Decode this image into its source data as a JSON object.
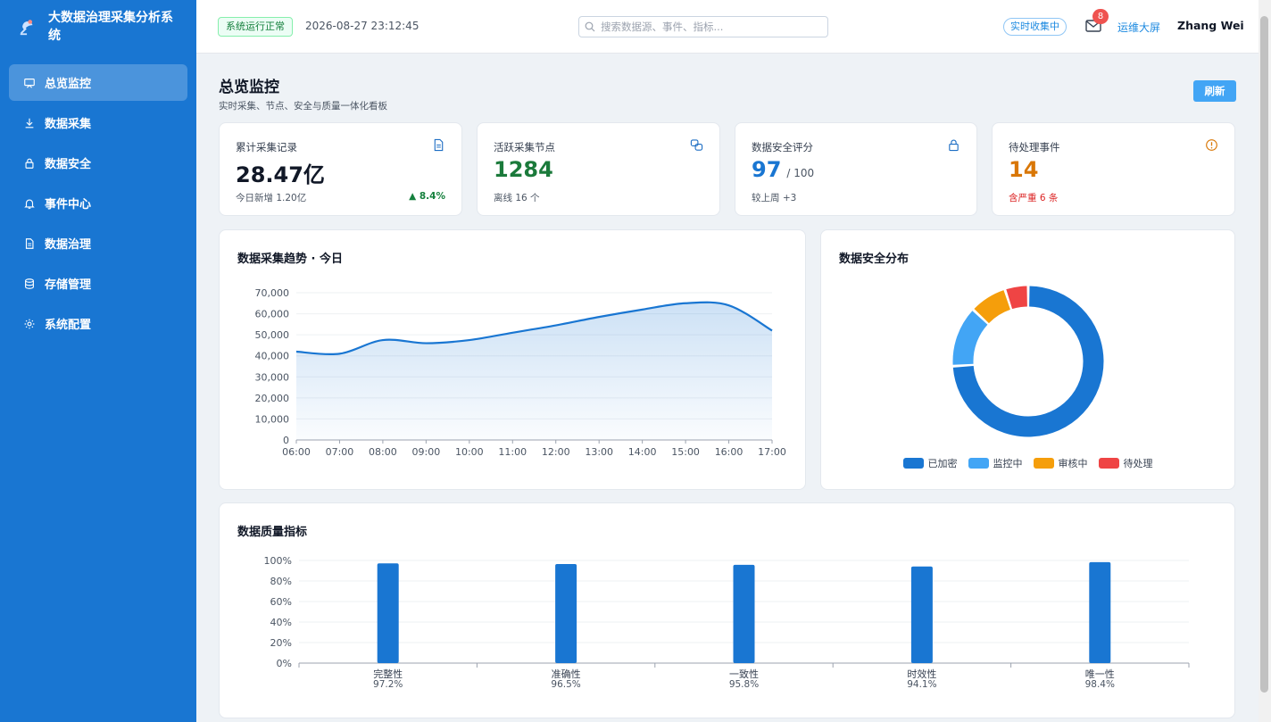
{
  "app": {
    "title": "大数据治理采集分析系统",
    "accent": "#1976d2"
  },
  "sidebar": {
    "items": [
      {
        "label": "总览监控",
        "icon": "monitor-icon",
        "active": true
      },
      {
        "label": "数据采集",
        "icon": "download-icon"
      },
      {
        "label": "数据安全",
        "icon": "lock-icon"
      },
      {
        "label": "事件中心",
        "icon": "bell-icon"
      },
      {
        "label": "数据治理",
        "icon": "document-icon"
      },
      {
        "label": "存储管理",
        "icon": "database-icon"
      },
      {
        "label": "系统配置",
        "icon": "gear-icon"
      }
    ]
  },
  "topbar": {
    "status": "系统运行正常",
    "datetime": "2026-08-27 23:12:45",
    "search_placeholder": "搜索数据源、事件、指标...",
    "live": "实时收集中",
    "mail_count": "8",
    "screen_link": "运维大屏",
    "user": "Zhang Wei"
  },
  "page": {
    "title": "总览监控",
    "subtitle": "实时采集、节点、安全与质量一体化看板",
    "refresh": "刷新"
  },
  "kpis": [
    {
      "label": "累计采集记录",
      "value": "28.47亿",
      "unit": "",
      "foot": "今日新增 1.20亿",
      "delta": "▲ 8.4%",
      "icon": "document-icon",
      "color": "#111827"
    },
    {
      "label": "活跃采集节点",
      "value": "1284",
      "unit": "",
      "foot": "离线 16 个",
      "delta": "",
      "icon": "nodes-icon",
      "color": "#1b7a3b"
    },
    {
      "label": "数据安全评分",
      "value": "97",
      "unit": "/ 100",
      "foot": "较上周 +3",
      "delta": "",
      "icon": "lock-icon",
      "color": "#1976d2"
    },
    {
      "label": "待处理事件",
      "value": "14",
      "unit": "",
      "foot": "含严重 6 条",
      "delta": "",
      "icon": "alert-icon",
      "color": "#d97706"
    }
  ],
  "charts": {
    "trend_title": "数据采集趋势 · 今日",
    "security_title": "数据安全分布",
    "quality_title": "数据质量指标"
  },
  "chart_data": [
    {
      "type": "area",
      "title": "数据采集趋势 · 今日",
      "x": [
        "06:00",
        "07:00",
        "08:00",
        "09:00",
        "10:00",
        "11:00",
        "12:00",
        "13:00",
        "14:00",
        "15:00",
        "16:00",
        "17:00"
      ],
      "y_ticks": [
        "0",
        "10,000",
        "20,000",
        "30,000",
        "40,000",
        "50,000",
        "60,000",
        "70,000"
      ],
      "ylim": [
        0,
        70000
      ],
      "series": [
        {
          "values": [
            42000,
            41000,
            47500,
            46000,
            47500,
            51000,
            54500,
            58500,
            62000,
            65000,
            64000,
            52000
          ]
        }
      ],
      "grid": true,
      "color": "#1976d2"
    },
    {
      "type": "pie",
      "title": "数据安全分布",
      "donut": true,
      "labels": [
        "已加密",
        "监控中",
        "审核中",
        "待处理"
      ],
      "values": [
        74,
        13,
        8,
        5
      ],
      "colors": [
        "#1976d2",
        "#42a5f5",
        "#f59e0b",
        "#ef4444"
      ],
      "legend": "bottom"
    },
    {
      "type": "bar",
      "title": "数据质量指标",
      "categories": [
        "完整性",
        "准确性",
        "一致性",
        "时效性",
        "唯一性"
      ],
      "value_labels": [
        "97.2%",
        "96.5%",
        "95.8%",
        "94.1%",
        "98.4%"
      ],
      "values": [
        97.2,
        96.5,
        95.8,
        94.1,
        98.4
      ],
      "y_ticks": [
        "0%",
        "20%",
        "40%",
        "60%",
        "80%",
        "100%"
      ],
      "ylim": [
        0,
        100
      ],
      "color": "#1976d2"
    }
  ]
}
